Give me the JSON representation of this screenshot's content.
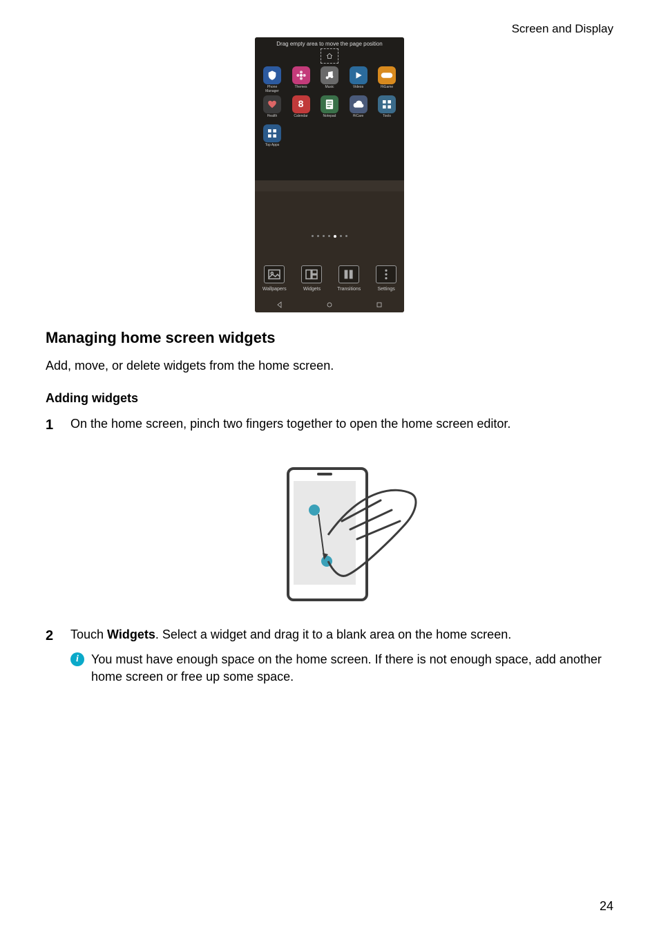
{
  "header": {
    "section": "Screen and Display"
  },
  "page_number": "24",
  "screenshot": {
    "tip": "Drag empty area to move the page position",
    "apps_row1": [
      {
        "label": "Phone Manager",
        "color": "#2c5aa0",
        "glyph": "shield"
      },
      {
        "label": "Themes",
        "color": "#c33b7a",
        "glyph": "flower"
      },
      {
        "label": "Music",
        "color": "#6a6a6a",
        "glyph": "note"
      },
      {
        "label": "Videos",
        "color": "#2b6b9c",
        "glyph": "play"
      },
      {
        "label": "HiGame",
        "color": "#d88a1e",
        "glyph": "game"
      }
    ],
    "apps_row2": [
      {
        "label": "Health",
        "color": "#3a3a3a",
        "glyph": "heart"
      },
      {
        "label": "Calendar",
        "color": "#c13a3a",
        "glyph": "8"
      },
      {
        "label": "Notepad",
        "color": "#3a7049",
        "glyph": "notes"
      },
      {
        "label": "HiCare",
        "color": "#4a5a7a",
        "glyph": "cloud"
      },
      {
        "label": "Tools",
        "color": "#3b6b8a",
        "glyph": "grid"
      }
    ],
    "apps_row3": [
      {
        "label": "Top Apps",
        "color": "#2b5a8a",
        "glyph": "grid"
      }
    ],
    "options": [
      {
        "label": "Wallpapers"
      },
      {
        "label": "Widgets"
      },
      {
        "label": "Transitions"
      },
      {
        "label": "Settings"
      }
    ]
  },
  "content": {
    "h2": "Managing home screen widgets",
    "intro": "Add, move, or delete widgets from the home screen.",
    "h3": "Adding widgets",
    "step1": "On the home screen, pinch two fingers together to open the home screen editor.",
    "step2_pre": "Touch ",
    "step2_bold": "Widgets",
    "step2_post": ". Select a widget and drag it to a blank area on the home screen.",
    "note": "You must have enough space on the home screen. If there is not enough space, add another home screen or free up some space."
  }
}
